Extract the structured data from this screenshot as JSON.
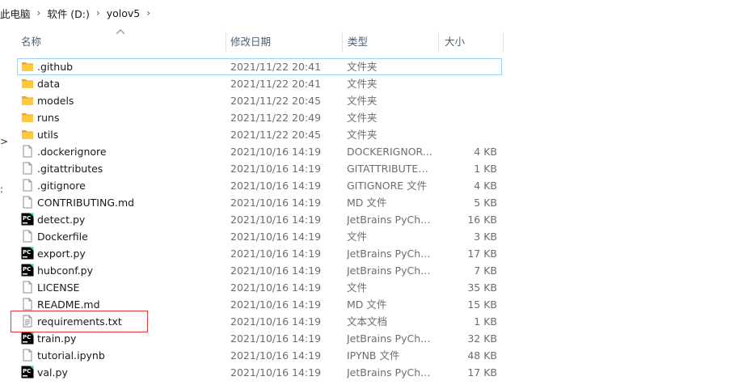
{
  "breadcrumb": [
    "此电脑",
    "软件 (D:)",
    "yolov5"
  ],
  "columns": {
    "name": "名称",
    "date": "修改日期",
    "type": "类型",
    "size": "大小"
  },
  "files": [
    {
      "name": ".github",
      "date": "2021/11/22 20:41",
      "type": "文件夹",
      "size": "",
      "icon": "folder-icon"
    },
    {
      "name": "data",
      "date": "2021/11/22 20:41",
      "type": "文件夹",
      "size": "",
      "icon": "folder-icon"
    },
    {
      "name": "models",
      "date": "2021/11/22 20:45",
      "type": "文件夹",
      "size": "",
      "icon": "folder-icon"
    },
    {
      "name": "runs",
      "date": "2021/11/22 20:49",
      "type": "文件夹",
      "size": "",
      "icon": "folder-icon"
    },
    {
      "name": "utils",
      "date": "2021/11/22 20:45",
      "type": "文件夹",
      "size": "",
      "icon": "folder-icon"
    },
    {
      "name": ".dockerignore",
      "date": "2021/10/16 14:19",
      "type": "DOCKERIGNOR...",
      "size": "4 KB",
      "icon": "blank-file-icon"
    },
    {
      "name": ".gitattributes",
      "date": "2021/10/16 14:19",
      "type": "GITATTRIBUTES ...",
      "size": "1 KB",
      "icon": "blank-file-icon"
    },
    {
      "name": ".gitignore",
      "date": "2021/10/16 14:19",
      "type": "GITIGNORE 文件",
      "size": "4 KB",
      "icon": "blank-file-icon"
    },
    {
      "name": "CONTRIBUTING.md",
      "date": "2021/10/16 14:19",
      "type": "MD 文件",
      "size": "5 KB",
      "icon": "blank-file-icon"
    },
    {
      "name": "detect.py",
      "date": "2021/10/16 14:19",
      "type": "JetBrains PyChar...",
      "size": "16 KB",
      "icon": "pycharm-icon"
    },
    {
      "name": "Dockerfile",
      "date": "2021/10/16 14:19",
      "type": "文件",
      "size": "3 KB",
      "icon": "blank-file-icon"
    },
    {
      "name": "export.py",
      "date": "2021/10/16 14:19",
      "type": "JetBrains PyChar...",
      "size": "17 KB",
      "icon": "pycharm-icon"
    },
    {
      "name": "hubconf.py",
      "date": "2021/10/16 14:19",
      "type": "JetBrains PyChar...",
      "size": "7 KB",
      "icon": "pycharm-icon"
    },
    {
      "name": "LICENSE",
      "date": "2021/10/16 14:19",
      "type": "文件",
      "size": "35 KB",
      "icon": "blank-file-icon"
    },
    {
      "name": "README.md",
      "date": "2021/10/16 14:19",
      "type": "MD 文件",
      "size": "15 KB",
      "icon": "blank-file-icon"
    },
    {
      "name": "requirements.txt",
      "date": "2021/10/16 14:19",
      "type": "文本文档",
      "size": "1 KB",
      "icon": "text-file-icon"
    },
    {
      "name": "train.py",
      "date": "2021/10/16 14:19",
      "type": "JetBrains PyChar...",
      "size": "32 KB",
      "icon": "pycharm-icon"
    },
    {
      "name": "tutorial.ipynb",
      "date": "2021/10/16 14:19",
      "type": "IPYNB 文件",
      "size": "48 KB",
      "icon": "blank-file-icon"
    },
    {
      "name": "val.py",
      "date": "2021/10/16 14:19",
      "type": "JetBrains PyChar...",
      "size": "17 KB",
      "icon": "pycharm-icon"
    }
  ],
  "colors": {
    "folder": "#ffc83d",
    "highlight_border": "#e5383b",
    "focus_border": "#99d1ff",
    "pycharm_bg": "#000000"
  }
}
